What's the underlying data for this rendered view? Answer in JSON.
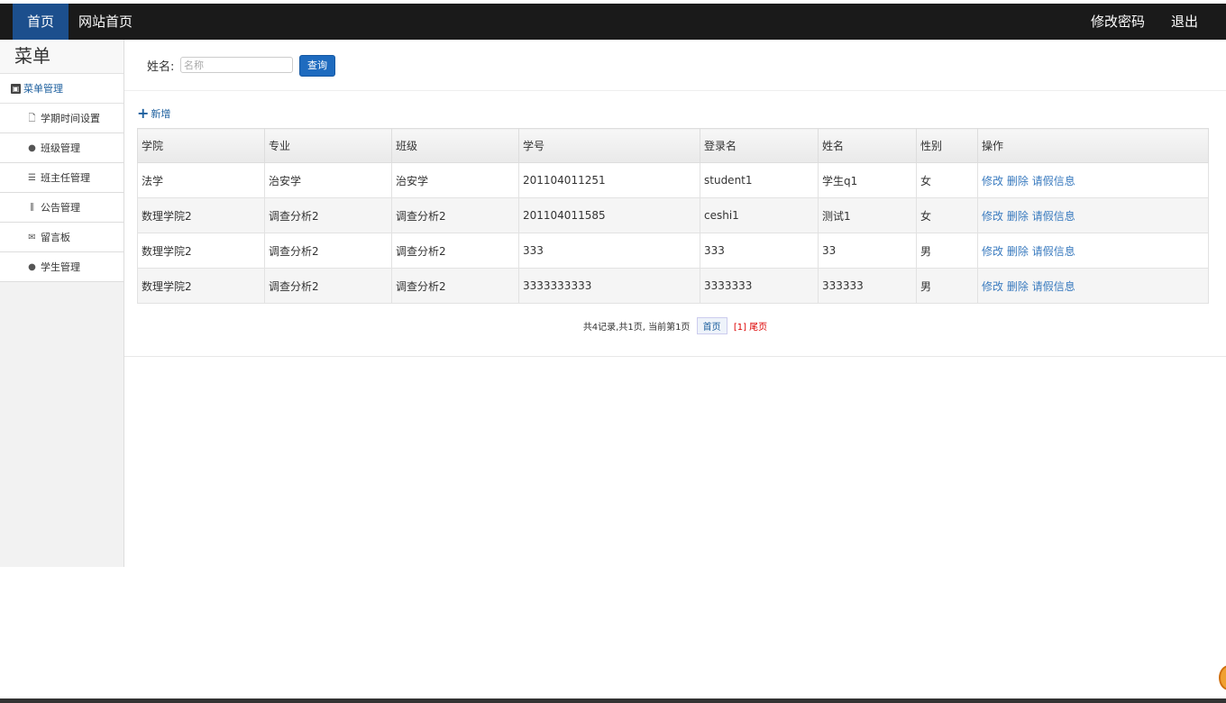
{
  "topnav": {
    "home": "首页",
    "site_home": "网站首页",
    "change_password": "修改密码",
    "logout": "退出"
  },
  "sidebar": {
    "title": "菜单",
    "group": "菜单管理",
    "items": [
      {
        "label": "学期时间设置",
        "icon": "file-icon"
      },
      {
        "label": "班级管理",
        "icon": "comment-icon"
      },
      {
        "label": "班主任管理",
        "icon": "list-icon"
      },
      {
        "label": "公告管理",
        "icon": "books-icon"
      },
      {
        "label": "留言板",
        "icon": "envelope-icon"
      },
      {
        "label": "学生管理",
        "icon": "comment-icon"
      }
    ]
  },
  "search": {
    "label": "姓名:",
    "placeholder": "名称",
    "value": "",
    "button": "查询"
  },
  "add_label": "新增",
  "table": {
    "headers": [
      "学院",
      "专业",
      "班级",
      "学号",
      "登录名",
      "姓名",
      "性别",
      "操作"
    ],
    "rows": [
      [
        "法学",
        "治安学",
        "治安学",
        "201104011251",
        "student1",
        "学生q1",
        "女"
      ],
      [
        "数理学院2",
        "调查分析2",
        "调查分析2",
        "201104011585",
        "ceshi1",
        "测试1",
        "女"
      ],
      [
        "数理学院2",
        "调查分析2",
        "调查分析2",
        "333",
        "333",
        "33",
        "男"
      ],
      [
        "数理学院2",
        "调查分析2",
        "调查分析2",
        "3333333333",
        "3333333",
        "333333",
        "男"
      ]
    ],
    "actions": [
      "修改",
      "删除",
      "请假信息"
    ]
  },
  "pager": {
    "summary": "共4记录,共1页, 当前第1页",
    "first": "首页",
    "page": "[1]",
    "last": "尾页"
  },
  "colors": {
    "topbar": "#1a1a1a",
    "nav_active": "#1c4f8d",
    "link": "#3a7bbf",
    "button": "#1e6bbf"
  }
}
